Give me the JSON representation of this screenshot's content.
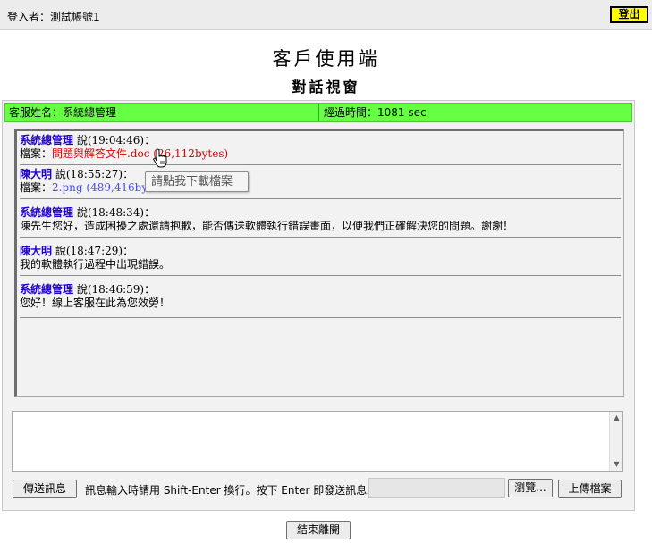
{
  "header": {
    "login_user": "登入者：測試帳號1",
    "logout_label": "登出"
  },
  "title": "客戶使用端",
  "subtitle": "對話視窗",
  "info": {
    "agent_label": "客服姓名：系統總管理",
    "elapsed_label": "經過時間：1081 sec"
  },
  "messages": [
    {
      "sender": "系統總管理",
      "said": " 說(19:04:46)：",
      "body_prefix": "檔案：",
      "file": "問題與解答文件.doc (26,112bytes)"
    },
    {
      "sender": "陳大明",
      "said": " 說(18:55:27)：",
      "body_prefix": "檔案：",
      "file": "2.png (489,416bytes)"
    },
    {
      "sender": "系統總管理",
      "said": " 說(18:48:34)：",
      "body": "陳先生您好，造成困擾之處還請抱歉，能否傳送軟體執行錯誤畫面，以便我們正確解決您的問題。謝謝！"
    },
    {
      "sender": "陳大明",
      "said": " 說(18:47:29)：",
      "body": "我的軟體執行過程中出現錯誤。"
    },
    {
      "sender": "系統總管理",
      "said": " 說(18:46:59)：",
      "body": "您好！線上客服在此為您效勞！"
    }
  ],
  "tooltip": "請點我下載檔案",
  "input": {
    "value": "",
    "placeholder": ""
  },
  "controls": {
    "send_label": "傳送訊息",
    "hint": "訊息輸入時請用 Shift-Enter 換行。按下 Enter 即發送訊息。",
    "browse_label": "瀏覽...",
    "upload_label": "上傳檔案",
    "end_label": "結束離開"
  },
  "colors": {
    "info_bar": "#66ff44",
    "logout_bg": "#ffff00",
    "sender": "#2200cc",
    "file_link_agent": "#dd0000",
    "file_link_user": "#4c4cff"
  }
}
